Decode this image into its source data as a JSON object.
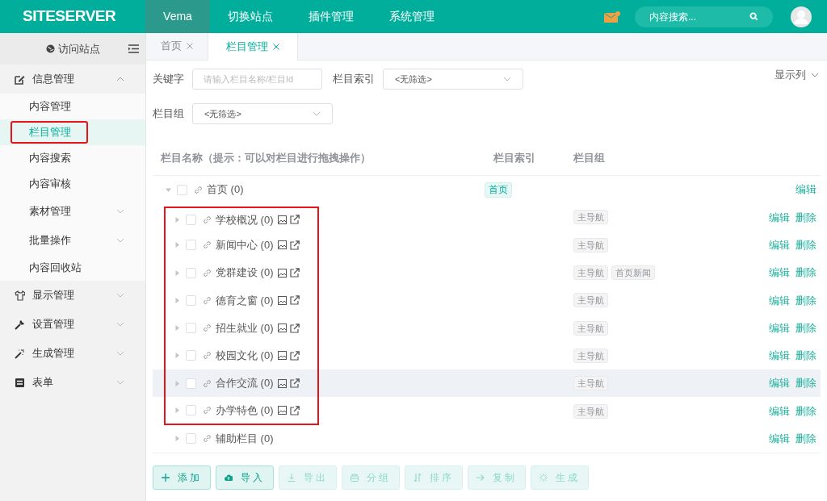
{
  "topbar": {
    "logo": "SITESERVER",
    "nav": [
      {
        "label": "Vema",
        "selected": true
      },
      {
        "label": "切换站点",
        "selected": false
      },
      {
        "label": "插件管理",
        "selected": false
      },
      {
        "label": "系统管理",
        "selected": false
      }
    ],
    "search": {
      "placeholder": "内容搜索..."
    }
  },
  "sidebar": {
    "visit_site": "访问站点",
    "items": [
      {
        "label": "信息管理",
        "expanded": true,
        "children": [
          {
            "label": "内容管理",
            "kind": "link",
            "selected": false,
            "annotated": false
          },
          {
            "label": "栏目管理",
            "kind": "link",
            "selected": true,
            "annotated": true
          },
          {
            "label": "内容搜索",
            "kind": "link",
            "selected": false,
            "annotated": false
          },
          {
            "label": "内容审核",
            "kind": "link",
            "selected": false,
            "annotated": false
          },
          {
            "label": "素材管理",
            "kind": "group",
            "selected": false,
            "annotated": false
          },
          {
            "label": "批量操作",
            "kind": "group",
            "selected": false,
            "annotated": false
          },
          {
            "label": "内容回收站",
            "kind": "link",
            "selected": false,
            "annotated": false
          }
        ]
      },
      {
        "label": "显示管理",
        "expanded": false
      },
      {
        "label": "设置管理",
        "expanded": false
      },
      {
        "label": "生成管理",
        "expanded": false
      },
      {
        "label": "表单",
        "expanded": false
      }
    ]
  },
  "tabs": [
    {
      "label": "首页",
      "selected": false
    },
    {
      "label": "栏目管理",
      "selected": true
    }
  ],
  "filters": {
    "keyword": {
      "label": "关键字",
      "placeholder": "请输入栏目名称/栏目Id"
    },
    "index": {
      "label": "栏目索引",
      "value": "<无筛选>"
    },
    "group": {
      "label": "栏目组",
      "value": "<无筛选>"
    },
    "columns_toggle": "显示列"
  },
  "table": {
    "columns": [
      "栏目名称（提示：可以对栏目进行拖拽操作）",
      "栏目索引",
      "栏目组"
    ],
    "rows": [
      {
        "name": "首页 (0)",
        "expanded": true,
        "preview_icons": false,
        "annotated": false,
        "hovered": false,
        "index": "首页",
        "actions": [
          "编辑"
        ],
        "children": [
          {
            "name": "学校概况 (0)",
            "expanded": false,
            "preview_icons": true,
            "annotated": true,
            "hovered": false,
            "groups": [
              "主导航"
            ],
            "actions": [
              "编辑",
              "删除"
            ]
          },
          {
            "name": "新闻中心 (0)",
            "expanded": false,
            "preview_icons": true,
            "annotated": true,
            "hovered": false,
            "groups": [
              "主导航"
            ],
            "actions": [
              "编辑",
              "删除"
            ]
          },
          {
            "name": "党群建设 (0)",
            "expanded": false,
            "preview_icons": true,
            "annotated": true,
            "hovered": false,
            "groups": [
              "主导航",
              "首页新闻"
            ],
            "actions": [
              "编辑",
              "删除"
            ]
          },
          {
            "name": "德育之窗 (0)",
            "expanded": false,
            "preview_icons": true,
            "annotated": true,
            "hovered": false,
            "groups": [
              "主导航"
            ],
            "actions": [
              "编辑",
              "删除"
            ]
          },
          {
            "name": "招生就业 (0)",
            "expanded": false,
            "preview_icons": true,
            "annotated": true,
            "hovered": false,
            "groups": [
              "主导航"
            ],
            "actions": [
              "编辑",
              "删除"
            ]
          },
          {
            "name": "校园文化 (0)",
            "expanded": false,
            "preview_icons": true,
            "annotated": true,
            "hovered": false,
            "groups": [
              "主导航"
            ],
            "actions": [
              "编辑",
              "删除"
            ]
          },
          {
            "name": "合作交流 (0)",
            "expanded": false,
            "preview_icons": true,
            "annotated": true,
            "hovered": true,
            "groups": [
              "主导航"
            ],
            "actions": [
              "编辑",
              "删除"
            ]
          },
          {
            "name": "办学特色 (0)",
            "expanded": false,
            "preview_icons": true,
            "annotated": true,
            "hovered": false,
            "groups": [
              "主导航"
            ],
            "actions": [
              "编辑",
              "删除"
            ]
          },
          {
            "name": "辅助栏目 (0)",
            "expanded": false,
            "preview_icons": false,
            "annotated": false,
            "hovered": false,
            "actions": [
              "编辑",
              "删除"
            ]
          }
        ]
      }
    ]
  },
  "buttons": [
    {
      "label": "添加",
      "disabled": false
    },
    {
      "label": "导入",
      "disabled": false
    },
    {
      "label": "导出",
      "disabled": true
    },
    {
      "label": "分组",
      "disabled": true
    },
    {
      "label": "排序",
      "disabled": true
    },
    {
      "label": "复制",
      "disabled": true
    },
    {
      "label": "生成",
      "disabled": true
    }
  ]
}
